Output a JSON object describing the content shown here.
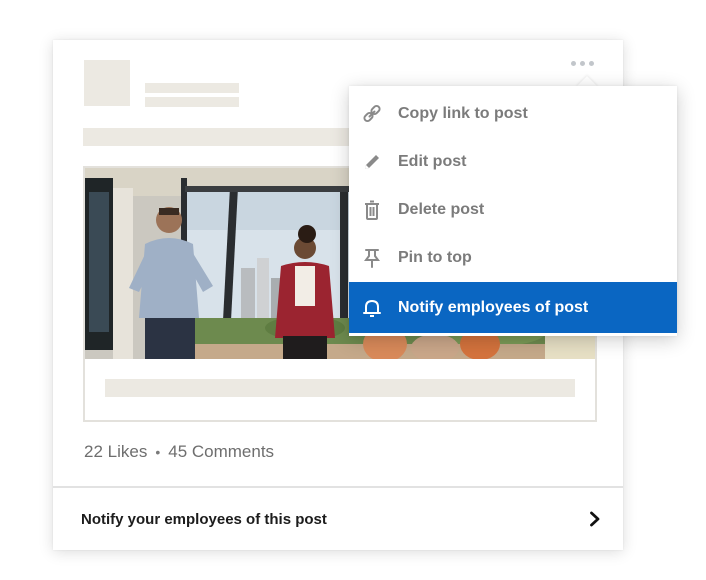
{
  "post": {
    "stats": {
      "likes": "22 Likes",
      "separator": "•",
      "comments": "45 Comments"
    },
    "footer_link_label": "Notify your employees of this post"
  },
  "menu": {
    "items": [
      {
        "label": "Copy link to post",
        "icon": "link-icon"
      },
      {
        "label": "Edit post",
        "icon": "pencil-icon"
      },
      {
        "label": "Delete post",
        "icon": "trash-icon"
      },
      {
        "label": "Pin to top",
        "icon": "pin-icon"
      },
      {
        "label": "Notify employees of post",
        "icon": "bell-icon",
        "active": true
      }
    ]
  },
  "colors": {
    "accent": "#0a66c2",
    "placeholder": "#ece9e2",
    "menu_text": "#7b7b7b"
  }
}
